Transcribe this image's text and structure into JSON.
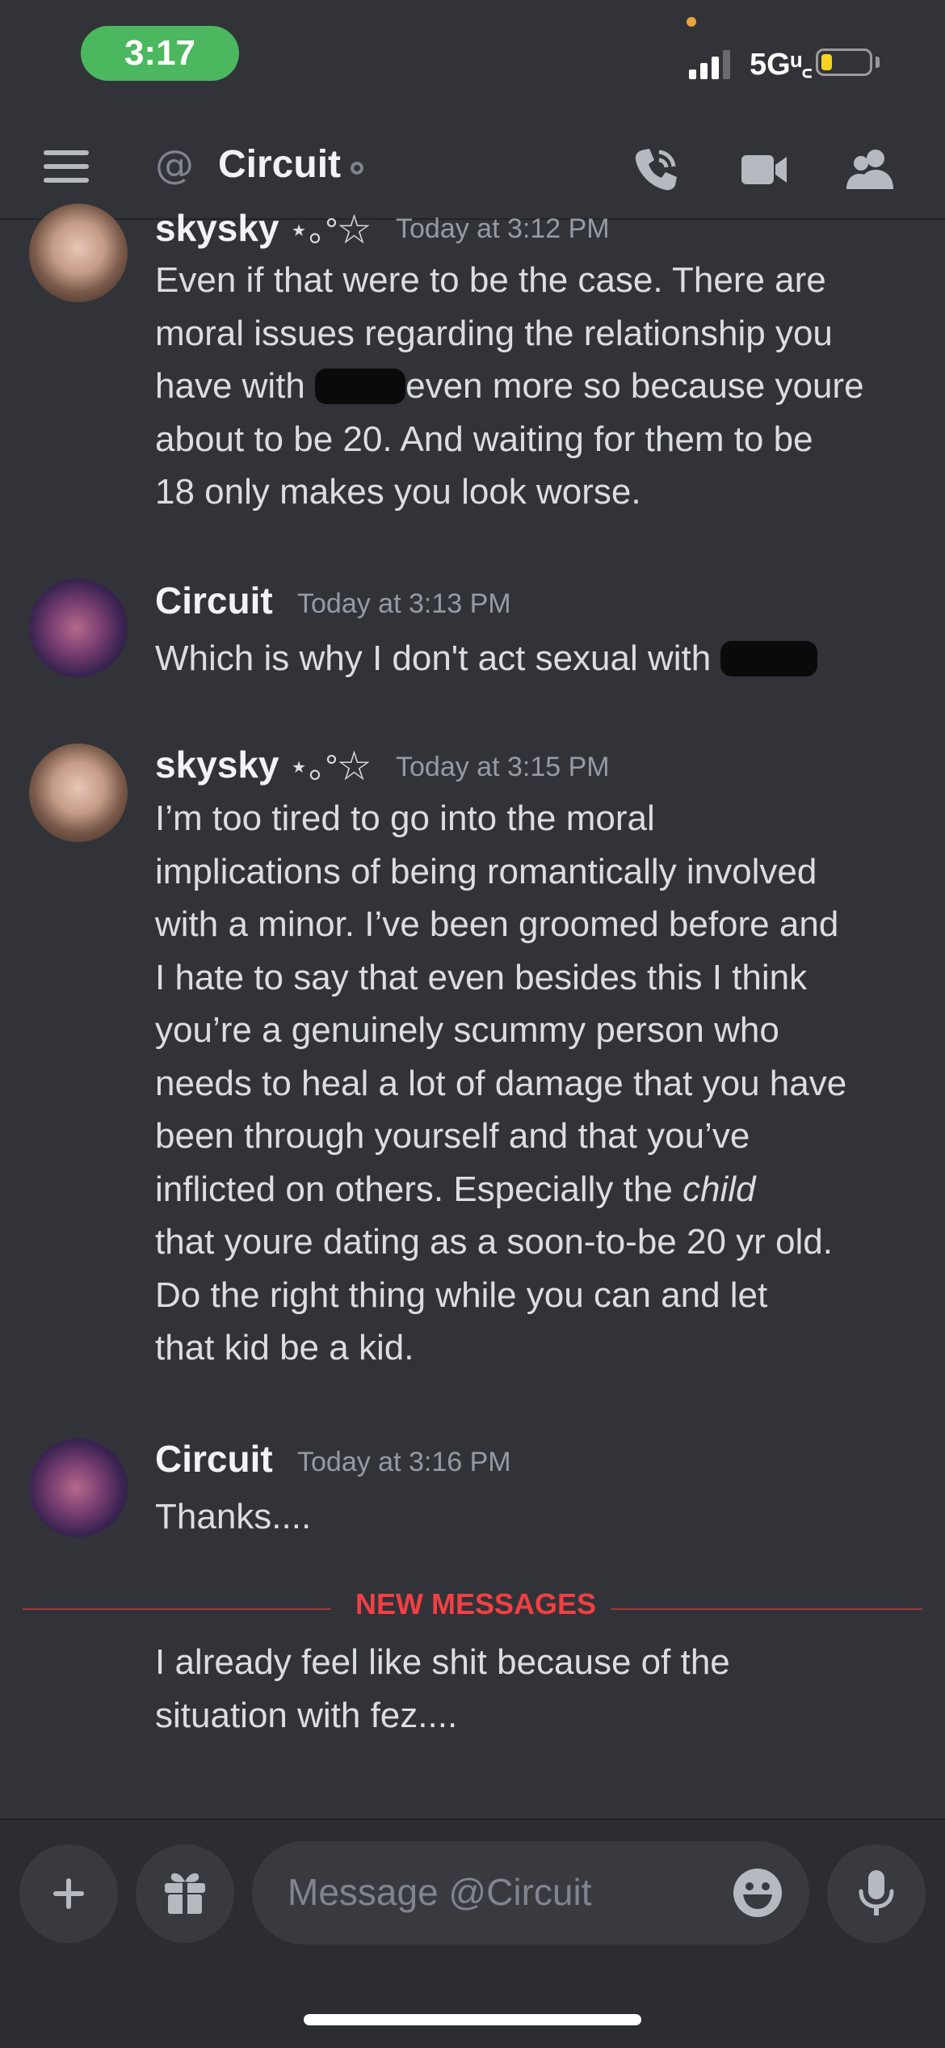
{
  "status_bar": {
    "time": "3:17",
    "network": "5Gᵘ꜀",
    "battery_level": 0.15,
    "colors": {
      "time_pill": "#4bb85f",
      "battery": "#f5d320"
    }
  },
  "header": {
    "at_symbol": "@",
    "channel_name": "Circuit",
    "icons": [
      "menu-icon",
      "call-icon",
      "video-icon",
      "members-icon"
    ]
  },
  "messages": [
    {
      "author": "skysky",
      "author_deco": "⋆｡°☆",
      "timestamp": "Today at 3:12 PM",
      "lines": [
        "Even if that were to be the case. There are",
        "moral issues regarding the relationship you",
        "have with [redacted] even more so because youre",
        "about to be 20. And waiting for them to be",
        "18 only makes you look worse."
      ],
      "line_parts": {
        "a": "have with ",
        "b": "even more so because youre"
      }
    },
    {
      "author": "Circuit",
      "timestamp": "Today at 3:13 PM",
      "text": "Which is why I don't act sexual with"
    },
    {
      "author": "skysky",
      "author_deco": "⋆｡°☆",
      "timestamp": "Today at 3:15 PM",
      "lines": [
        "I’m too tired to go into the moral",
        "implications of being romantically involved",
        "with a minor. I’ve been groomed before and",
        "I hate to say that even besides this I think",
        "you’re a genuinely scummy person who",
        "needs to heal a lot of damage that you have",
        "been through yourself and that you’ve",
        "inflicted on others. Especially the",
        "that youre dating as a soon-to-be 20 yr old.",
        "Do the right thing while you can and let",
        "that kid be a kid."
      ],
      "emphasis": "child"
    },
    {
      "author": "Circuit",
      "timestamp": "Today at 3:16 PM",
      "text": "Thanks...."
    }
  ],
  "new_messages_label": "NEW MESSAGES",
  "new_message": {
    "lines": [
      "I already feel like shit because of the",
      "situation with fez...."
    ]
  },
  "composer": {
    "placeholder": "Message @Circuit",
    "icons": [
      "plus-icon",
      "gift-icon",
      "emoji-icon",
      "mic-icon"
    ]
  }
}
